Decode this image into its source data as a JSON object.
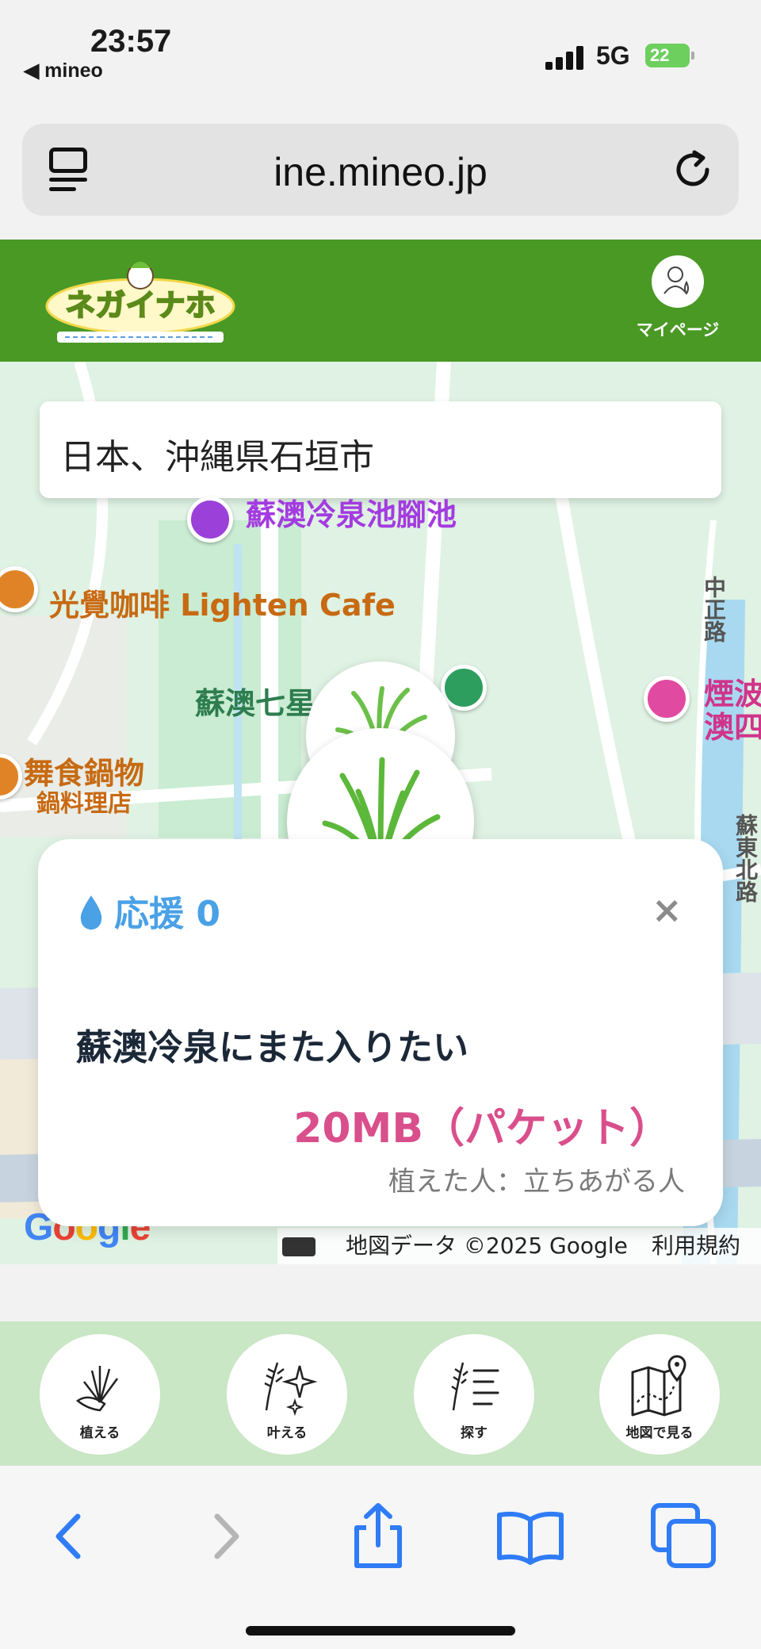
{
  "status_bar": {
    "time": "23:57",
    "back_app": "◀ mineo",
    "network": "5G",
    "battery": "22"
  },
  "browser": {
    "url": "ine.mineo.jp"
  },
  "site": {
    "mypage_label": "マイページ",
    "logo_alt": "ネガイナホ"
  },
  "map": {
    "search_value": "日本、沖縄県石垣市",
    "pois": {
      "spa_pool": "蘇澳冷泉池腳池",
      "cafe": "光覺咖啡 Lighten Cafe",
      "park": "蘇澳七星",
      "restaurant_line1": "舞食鍋物",
      "restaurant_line2": "鍋料理店",
      "hotel_line1": "煙波",
      "hotel_line2": "澳四",
      "road_east": "蘇東北路",
      "road_north": "中正路"
    },
    "google_logo": "Google",
    "attribution": "地図データ ©2025 Google",
    "terms": "利用規約"
  },
  "card": {
    "support_label": "応援 0",
    "close_symbol": "×",
    "wish_text": "蘇澳冷泉にまた入りたい",
    "reward": "20MB（パケット）",
    "planter": "植えた人：立ちあがる人"
  },
  "actions": [
    {
      "label": "植える",
      "icon": "plant-icon"
    },
    {
      "label": "叶える",
      "icon": "sparkle-icon"
    },
    {
      "label": "探す",
      "icon": "search-list-icon"
    },
    {
      "label": "地図で見る",
      "icon": "map-icon"
    }
  ],
  "colors": {
    "header_green": "#4a9925",
    "action_bar_green": "#c9e6c5",
    "support_blue": "#4aa1e6",
    "reward_pink": "#d94f8b",
    "safari_blue": "#2f7cf6"
  }
}
